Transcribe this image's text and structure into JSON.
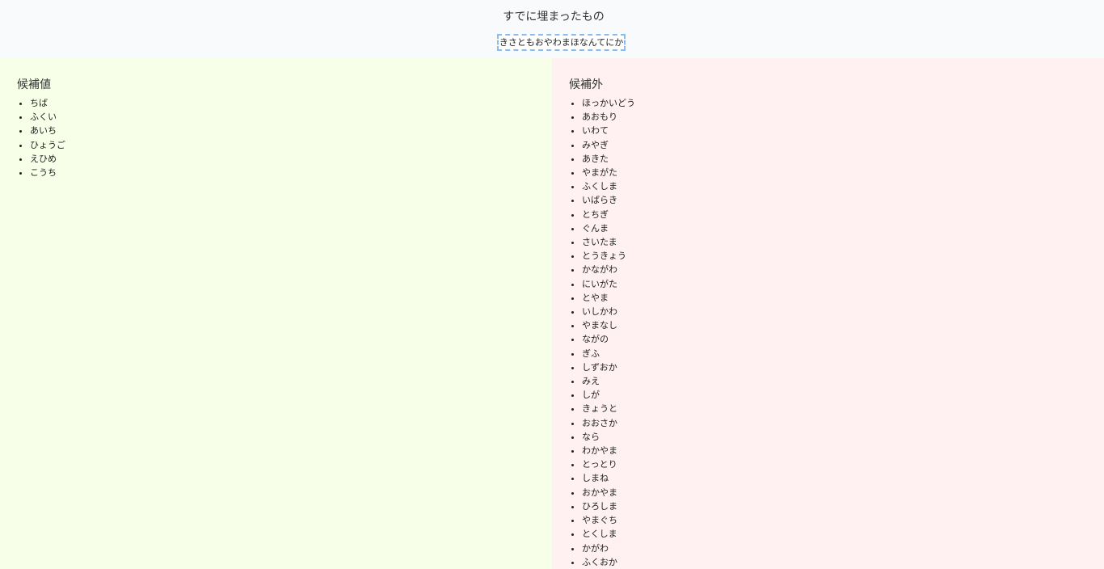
{
  "header": {
    "title": "すでに埋まったもの",
    "filled_value": "きさともおやわまほなんてにか"
  },
  "candidates": {
    "heading": "候補値",
    "items": [
      "ちば",
      "ふくい",
      "あいち",
      "ひょうご",
      "えひめ",
      "こうち"
    ]
  },
  "non_candidates": {
    "heading": "候補外",
    "items": [
      "ほっかいどう",
      "あおもり",
      "いわて",
      "みやぎ",
      "あきた",
      "やまがた",
      "ふくしま",
      "いばらき",
      "とちぎ",
      "ぐんま",
      "さいたま",
      "とうきょう",
      "かながわ",
      "にいがた",
      "とやま",
      "いしかわ",
      "やまなし",
      "ながの",
      "ぎふ",
      "しずおか",
      "みえ",
      "しが",
      "きょうと",
      "おおさか",
      "なら",
      "わかやま",
      "とっとり",
      "しまね",
      "おかやま",
      "ひろしま",
      "やまぐち",
      "とくしま",
      "かがわ",
      "ふくおか"
    ]
  },
  "colors": {
    "header_bg": "#f9fafc",
    "candidates_bg": "#f7ffe8",
    "non_candidates_bg": "#fff1f1",
    "focus_border": "#8bbcf0"
  }
}
